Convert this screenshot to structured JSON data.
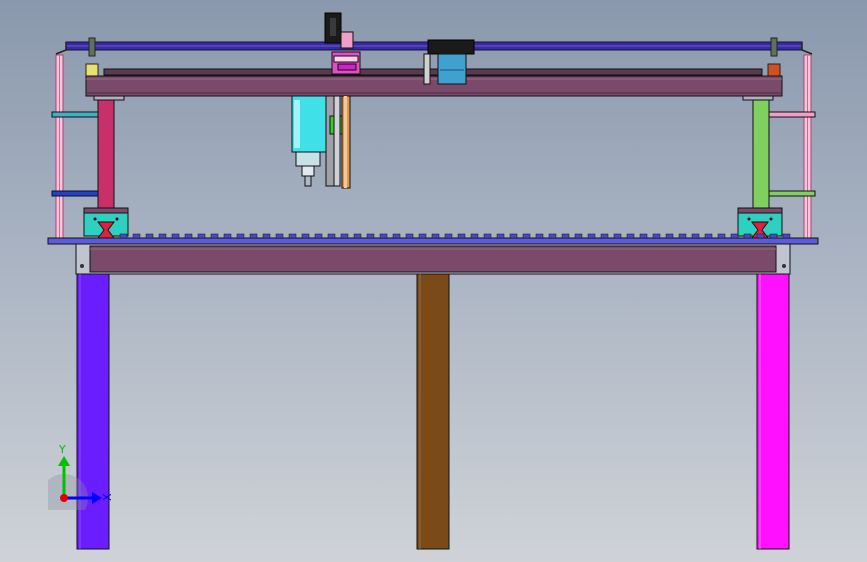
{
  "viewport": {
    "background_top": "#8a98ad",
    "background_bottom": "#cfd3d8"
  },
  "triad": {
    "y_label": "Y",
    "x_label": "X",
    "y_color": "#00c000",
    "x_color": "#0000ff",
    "origin_color": "#e00000"
  },
  "colors": {
    "frame_outline": "#1a1a1a",
    "main_beam": "#7a4a6a",
    "top_rod": "#3a2aa0",
    "left_leg": "#6a1eff",
    "middle_leg": "#7a4a18",
    "right_leg": "#ff10ff",
    "table_rail": "#5c5cd8",
    "left_upright": "#c8306a",
    "right_upright": "#80d060",
    "spindle_body": "#40e0e8",
    "carriage_block": "#30d0c0",
    "motor": "#1a1a1a",
    "pink_post": "#f0a0c8"
  },
  "parts": [
    "gantry-beam",
    "drive-rod",
    "spindle-head",
    "z-axis-slide",
    "y-carriage",
    "left-upright",
    "right-upright",
    "worktable-rail",
    "base-beam",
    "left-leg",
    "middle-leg",
    "right-leg"
  ]
}
